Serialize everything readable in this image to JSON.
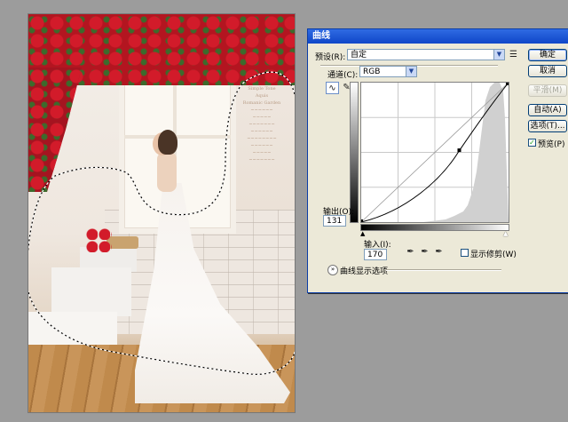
{
  "dialog": {
    "title": "曲线",
    "preset_label": "预设(R):",
    "preset_value": "自定",
    "channel_label": "通道(C):",
    "channel_value": "RGB",
    "output_label": "输出(O):",
    "output_value": "131",
    "input_label": "输入(I):",
    "input_value": "170",
    "show_clipping_label": "显示修剪(W)",
    "curve_display_options": "曲线显示选项",
    "buttons": {
      "ok": "确定",
      "cancel": "取消",
      "smooth": "平滑(M)",
      "auto": "自动(A)",
      "options": "选项(T)..."
    },
    "preview_label": "预览(P)",
    "preview_checked": true,
    "show_clipping_checked": false
  },
  "curve": {
    "control_point": {
      "input": 170,
      "output": 131
    },
    "range": [
      0,
      255
    ]
  },
  "icons": {
    "curve_tool": "curve-edit-icon",
    "pencil_tool": "pencil-icon",
    "preset_menu": "list-menu-icon",
    "black_eyedropper": "eyedropper-black-icon",
    "gray_eyedropper": "eyedropper-gray-icon",
    "white_eyedropper": "eyedropper-white-icon",
    "expand": "chevron-double-down-icon"
  },
  "photo": {
    "sign_lines": [
      "Simple Tone",
      "Aquis",
      "Romanic Garden",
      "",
      "~~~~~~",
      "~~~~~",
      "~~~~~~~",
      "~~~~~~",
      "~~~~~~~~",
      "~~~~~~",
      "~~~~~",
      "~~~~~~~"
    ]
  }
}
